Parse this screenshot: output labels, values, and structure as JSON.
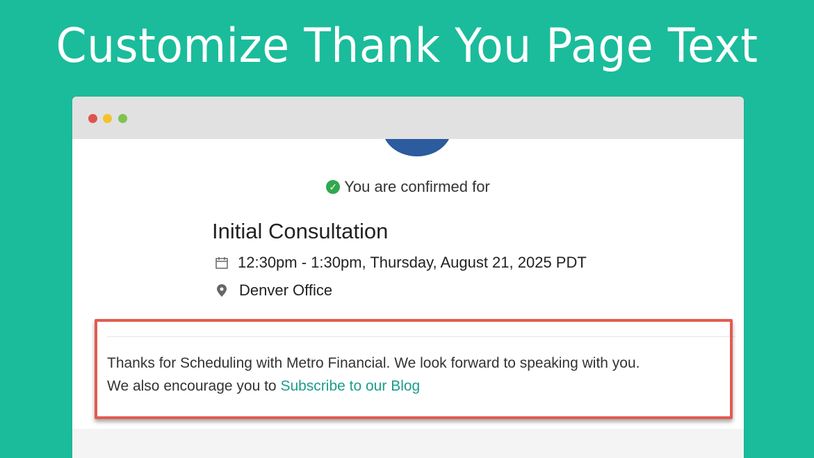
{
  "headline": "Customize Thank You Page Text",
  "browser": {
    "window_controls": [
      "close",
      "minimize",
      "maximize"
    ]
  },
  "confirmation": {
    "status_text": "You are confirmed for",
    "icon": "check-circle-icon",
    "event_title": "Initial Consultation",
    "time_text": "12:30pm - 1:30pm, Thursday, August 21, 2025 PDT",
    "location_text": "Denver Office"
  },
  "message": {
    "line1": "Thanks for Scheduling with Metro Financial. We look forward to speaking with you.",
    "line2_prefix": "We also encourage you to ",
    "link_text": "Subscribe to our Blog"
  },
  "colors": {
    "background": "#1bbc9b",
    "highlight_border": "#e45b4f",
    "link": "#1c9c8c",
    "check": "#2fa84f"
  }
}
